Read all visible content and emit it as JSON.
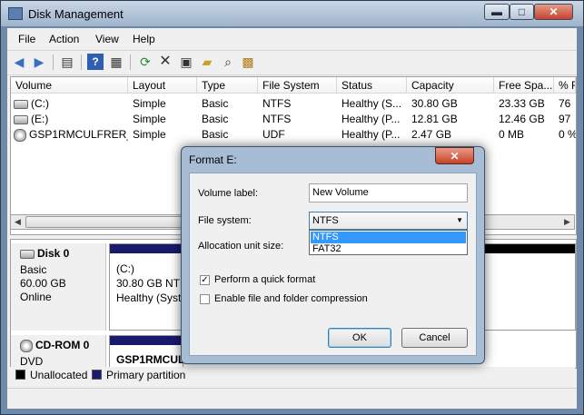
{
  "window": {
    "title": "Disk Management"
  },
  "titlebar_buttons": {
    "min": "▬",
    "max": "□",
    "close": "✕"
  },
  "menu": [
    "File",
    "Action",
    "View",
    "Help"
  ],
  "toolbar_icons": [
    "back-icon",
    "forward-icon",
    "console-tree-icon",
    "help-icon",
    "properties-icon",
    "refresh-icon",
    "delete-icon",
    "properties-sheet-icon",
    "open-icon",
    "find-icon",
    "settings-icon"
  ],
  "volume_list": {
    "columns": [
      "Volume",
      "Layout",
      "Type",
      "File System",
      "Status",
      "Capacity",
      "Free Spa...",
      "% F"
    ],
    "rows": [
      {
        "icon": "drive-icon",
        "cells": [
          "(C:)",
          "Simple",
          "Basic",
          "NTFS",
          "Healthy (S...",
          "30.80 GB",
          "23.33 GB",
          "76"
        ]
      },
      {
        "icon": "drive-icon",
        "cells": [
          "(E:)",
          "Simple",
          "Basic",
          "NTFS",
          "Healthy (P...",
          "12.81 GB",
          "12.46 GB",
          "97"
        ]
      },
      {
        "icon": "cd-icon",
        "cells": [
          "GSP1RMCULFRER_...",
          "Simple",
          "Basic",
          "UDF",
          "Healthy (P...",
          "2.47 GB",
          "0 MB",
          "0 %"
        ]
      }
    ]
  },
  "disks": [
    {
      "name": "Disk 0",
      "type": "Basic",
      "size": "60.00 GB",
      "state": "Online",
      "partition_name": "(C:)",
      "partition_info": "30.80 GB NTFS",
      "partition_status": "Healthy (Syste"
    },
    {
      "name": "CD-ROM 0",
      "type": "DVD",
      "partition_name": "GSP1RMCULI"
    }
  ],
  "legend": [
    {
      "label": "Unallocated",
      "color": "#000000"
    },
    {
      "label": "Primary partition",
      "color": "#19196e"
    }
  ],
  "dialog": {
    "title": "Format E:",
    "close": "✕",
    "volume_label_caption": "Volume label:",
    "volume_label_value": "New Volume",
    "file_system_caption": "File system:",
    "file_system_value": "NTFS",
    "file_system_options": [
      "NTFS",
      "FAT32"
    ],
    "allocation_caption": "Allocation unit size:",
    "quick_format_label": "Perform a quick format",
    "quick_format_checked": true,
    "compression_label": "Enable file and folder compression",
    "compression_checked": false,
    "ok_label": "OK",
    "cancel_label": "Cancel"
  },
  "colors": {
    "selection": "#3399ff",
    "partition_bar": "#19196e",
    "dialog_frame": "#a7bcd5"
  }
}
